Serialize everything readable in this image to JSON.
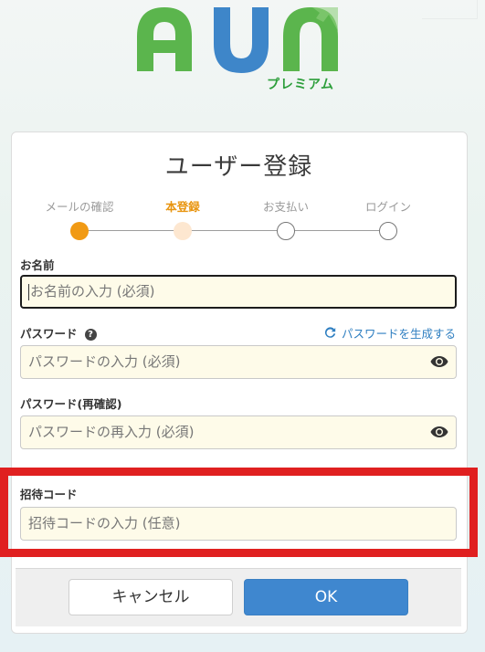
{
  "logo": {
    "text": "AUN",
    "subtitle": "プレミアム",
    "colors": {
      "green": "#5bb54d",
      "blue": "#3e86c9"
    }
  },
  "page": {
    "title": "ユーザー登録"
  },
  "steps": [
    {
      "label": "メールの確認",
      "state": "done"
    },
    {
      "label": "本登録",
      "state": "current"
    },
    {
      "label": "お支払い",
      "state": "pending"
    },
    {
      "label": "ログイン",
      "state": "pending"
    }
  ],
  "form": {
    "name": {
      "label": "お名前",
      "placeholder": "お名前の入力 (必須)"
    },
    "password": {
      "label": "パスワード",
      "placeholder": "パスワードの入力 (必須)",
      "help_icon": "question-circle-icon"
    },
    "generate_link": "パスワードを生成する",
    "password_confirm": {
      "label": "パスワード(再確認)",
      "placeholder": "パスワードの再入力 (必須)"
    },
    "invite_code": {
      "label": "招待コード",
      "placeholder": "招待コードの入力 (任意)"
    }
  },
  "buttons": {
    "cancel": "キャンセル",
    "ok": "OK"
  },
  "accent": {
    "step_done": "#f19a14",
    "link": "#2f7fc1",
    "ok_button": "#3f87cf",
    "highlight": "#e02020"
  }
}
